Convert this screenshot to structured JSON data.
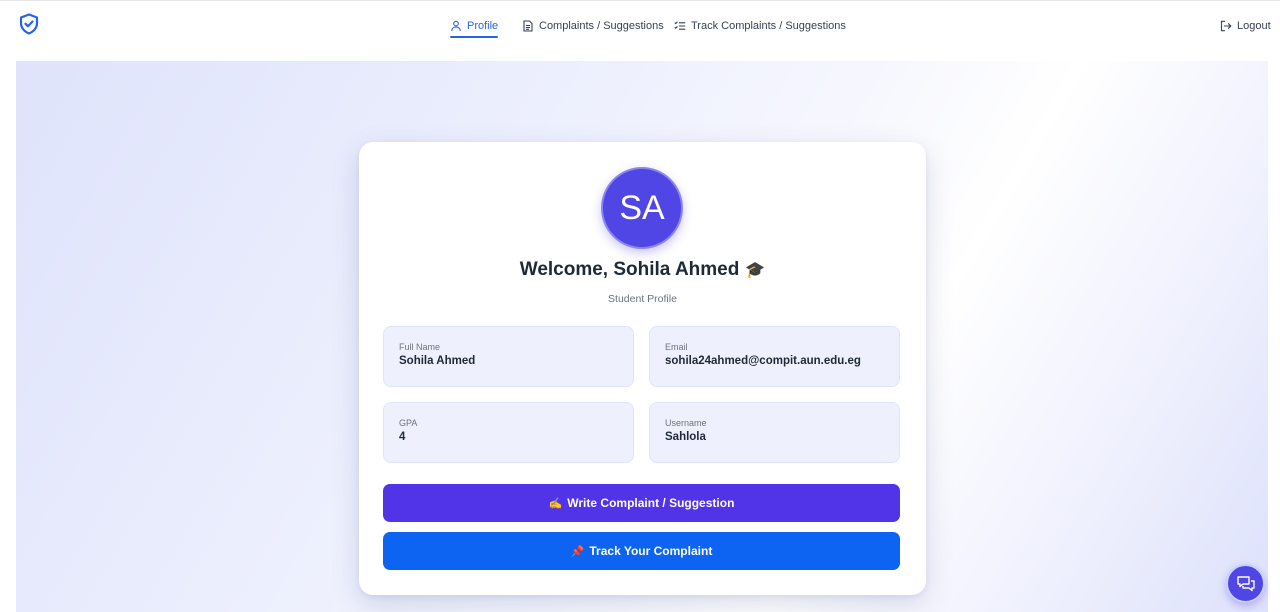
{
  "nav": {
    "profile_label": "Profile",
    "complaints_label": "Complaints / Suggestions",
    "track_label": "Track Complaints / Suggestions",
    "logout_label": "Logout"
  },
  "profile": {
    "initials": "SA",
    "welcome": "Welcome, Sohila Ahmed",
    "welcome_emoji": "🎓",
    "subtitle": "Student Profile",
    "fields": [
      {
        "label": "Full Name",
        "value": "Sohila Ahmed"
      },
      {
        "label": "Email",
        "value": "sohila24ahmed@compit.aun.edu.eg"
      },
      {
        "label": "GPA",
        "value": "4"
      },
      {
        "label": "Username",
        "value": "Sahlola"
      }
    ]
  },
  "actions": {
    "write_emoji": "✍️",
    "write_label": "Write Complaint / Suggestion",
    "track_emoji": "📌",
    "track_label": "Track Your Complaint"
  },
  "colors": {
    "accent": "#2563eb",
    "avatar": "#4f46e5",
    "write_button": "#5133e8",
    "track_button": "#0d63f2"
  },
  "icons": {
    "logo": "shield-check-icon",
    "profile": "user-icon",
    "complaints": "document-icon",
    "track": "checklist-icon",
    "logout": "logout-icon",
    "chat": "chat-icon"
  }
}
